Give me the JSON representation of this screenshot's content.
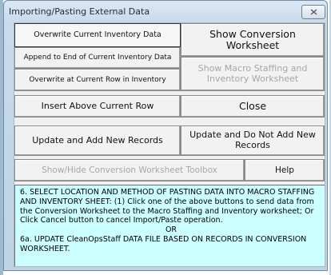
{
  "window": {
    "title": "Importing/Pasting External Data"
  },
  "buttons": {
    "overwrite_inventory": "Overwrite Current Inventory Data",
    "show_conversion": "Show Conversion Worksheet",
    "append_to_end": "Append to End of Current Inventory Data",
    "overwrite_at_row": "Overwrite at Current Row in Inventory",
    "show_macro_staffing": "Show Macro Staffing and Inventory Worksheet",
    "insert_above": "Insert Above Current Row",
    "close": "Close",
    "update_add": "Update and Add New Records",
    "update_no_add": "Update and Do Not Add New Records",
    "show_hide_toolbox": "Show/Hide Conversion Worksheet Toolbox",
    "help": "Help"
  },
  "instructions": {
    "step6": "6.  SELECT LOCATION AND METHOD OF PASTING DATA INTO MACRO STAFFING AND INVENTORY SHEET: (1) Click one of the above buttons to send data from the Conversion Worksheet to the Macro Staffing and Inventory worksheet; Or Click Cancel button to cancel Import/Paste operation.",
    "or": "OR",
    "step6a": "6a. UPDATE CleanOpsStaff DATA FILE BASED ON RECORDS IN CONVERSION WORKSHEET."
  },
  "icons": {
    "close": "close-x-icon"
  },
  "colors": {
    "dialog_background": "#f0f0f0",
    "instructions_background": "#ccffff",
    "disabled_text": "#a6a6a6"
  }
}
